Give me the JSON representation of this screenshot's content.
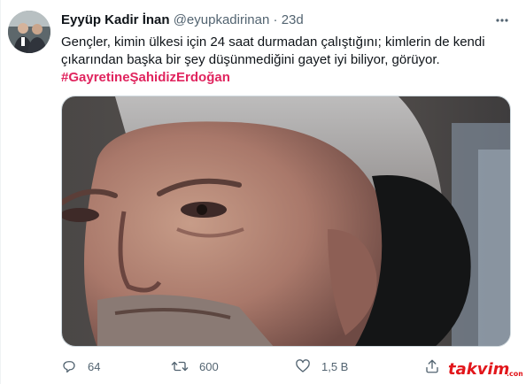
{
  "tweet": {
    "display_name": "Eyyüp Kadir İnan",
    "handle": "@eyupkadirinan",
    "separator": "·",
    "time": "23d",
    "text": "Gençler, kimin ülkesi için 24 saat durmadan çalıştığını; kimlerin de kendi çıkarından başka bir şey düşünmediğini gayet iyi biliyor, görüyor.",
    "hashtag": "#GayretineŞahidizErdoğan",
    "hashtag_color": "#e0245e"
  },
  "actions": {
    "replies": "64",
    "retweets": "600",
    "likes": "1,5 B"
  },
  "icons": [
    "more-icon",
    "reply-icon",
    "retweet-icon",
    "like-icon",
    "share-icon"
  ],
  "watermark": {
    "text": "takvim",
    "suffix": ".com",
    "color": "#e2161b"
  }
}
